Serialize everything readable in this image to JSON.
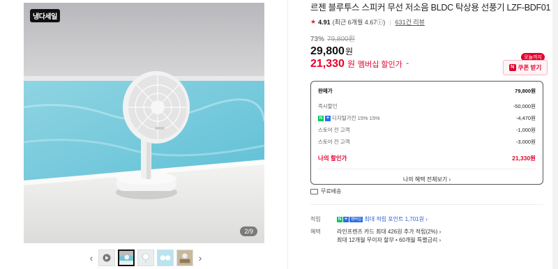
{
  "gallery": {
    "badge": "냉다세일",
    "counter": "2/9",
    "prev": "‹",
    "next": "›"
  },
  "product": {
    "title": "르젠 블루투스 스피커 무선 저소음 BLDC 탁상용 선풍기 LZF-BDF01",
    "rating": "4.91",
    "rating_note": "(최근 6개월 4.67ⓘ)",
    "review_count": "631건 리뷰",
    "discount_pct": "73%",
    "original_price": "79,800원",
    "price": "29,800",
    "price_unit": "원",
    "member_price": "21,330",
    "member_unit": "원",
    "member_label": "멤버십 할인가",
    "member_caret": "⌃"
  },
  "coupon": {
    "tag": "오늘까지",
    "label": "쿠폰 받기",
    "n": "N"
  },
  "breakdown": {
    "sale_label": "판매가",
    "sale_value": "79,800원",
    "rows": [
      {
        "label": "즉시할인",
        "value": "-50,000원"
      },
      {
        "label": "디지털가전 15% 15%",
        "value": "-4,470원"
      },
      {
        "label": "스토어 전 고객",
        "value": "-1,000원"
      },
      {
        "label": "스토어 전 고객",
        "value": "-3,000원"
      }
    ],
    "mine_label": "나의 할인가",
    "mine_value": "21,330원",
    "benefit_link": "나의 혜택 전체보기 ›"
  },
  "shipping": {
    "label": "무료배송"
  },
  "info": {
    "points_key": "적립",
    "points_badge": "멤버십",
    "points_value": "최대 적립 포인트 1,701원 ›",
    "benefit_key": "혜택",
    "benefit_line1": "라인프렌즈 카드 최대 426원 추가 적립(2%) ›",
    "benefit_line2": "최대 12개월 무이자 할부 • 60개월 특별금리 ›"
  },
  "colors": {
    "accent_red": "#e4002b",
    "naver_green": "#03c75a",
    "plus_blue": "#2a6ee8"
  }
}
